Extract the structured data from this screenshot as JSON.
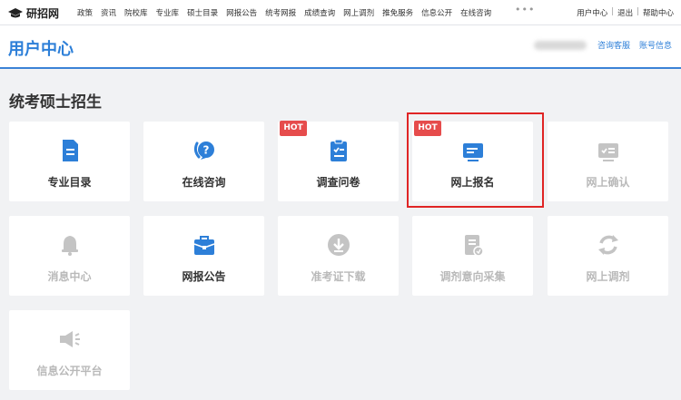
{
  "topbar": {
    "logo_text": "研招网",
    "nav": [
      "政策",
      "资讯",
      "院校库",
      "专业库",
      "硕士目录",
      "网报公告",
      "统考网报",
      "成绩查询",
      "网上调剂",
      "推免服务",
      "信息公开",
      "在线咨询"
    ],
    "more": "•••",
    "links": {
      "user_center": "用户中心",
      "logout": "退出",
      "help": "帮助中心",
      "sep": "|"
    }
  },
  "header": {
    "title": "用户中心",
    "links": {
      "consult": "咨询客服",
      "account": "账号信息"
    }
  },
  "section": {
    "title": "统考硕士招生"
  },
  "badge_hot": "HOT",
  "cards": [
    {
      "label": "专业目录",
      "icon": "document-icon",
      "enabled": true
    },
    {
      "label": "在线咨询",
      "icon": "question-bubble-icon",
      "enabled": true
    },
    {
      "label": "调查问卷",
      "icon": "clipboard-icon",
      "enabled": true,
      "hot": true
    },
    {
      "label": "网上报名",
      "icon": "form-icon",
      "enabled": true,
      "hot": true,
      "highlighted": true
    },
    {
      "label": "网上确认",
      "icon": "id-card-icon",
      "enabled": false
    },
    {
      "label": "消息中心",
      "icon": "bell-icon",
      "enabled": false
    },
    {
      "label": "网报公告",
      "icon": "briefcase-icon",
      "enabled": true
    },
    {
      "label": "准考证下载",
      "icon": "download-icon",
      "enabled": false
    },
    {
      "label": "调剂意向采集",
      "icon": "collect-icon",
      "enabled": false
    },
    {
      "label": "网上调剂",
      "icon": "refresh-icon",
      "enabled": false
    },
    {
      "label": "信息公开平台",
      "icon": "megaphone-icon",
      "enabled": false
    }
  ],
  "colors": {
    "accent": "#2d7fd8",
    "disabled": "#c4c4c4",
    "hot": "#e64c4c",
    "highlight": "#e02525"
  }
}
